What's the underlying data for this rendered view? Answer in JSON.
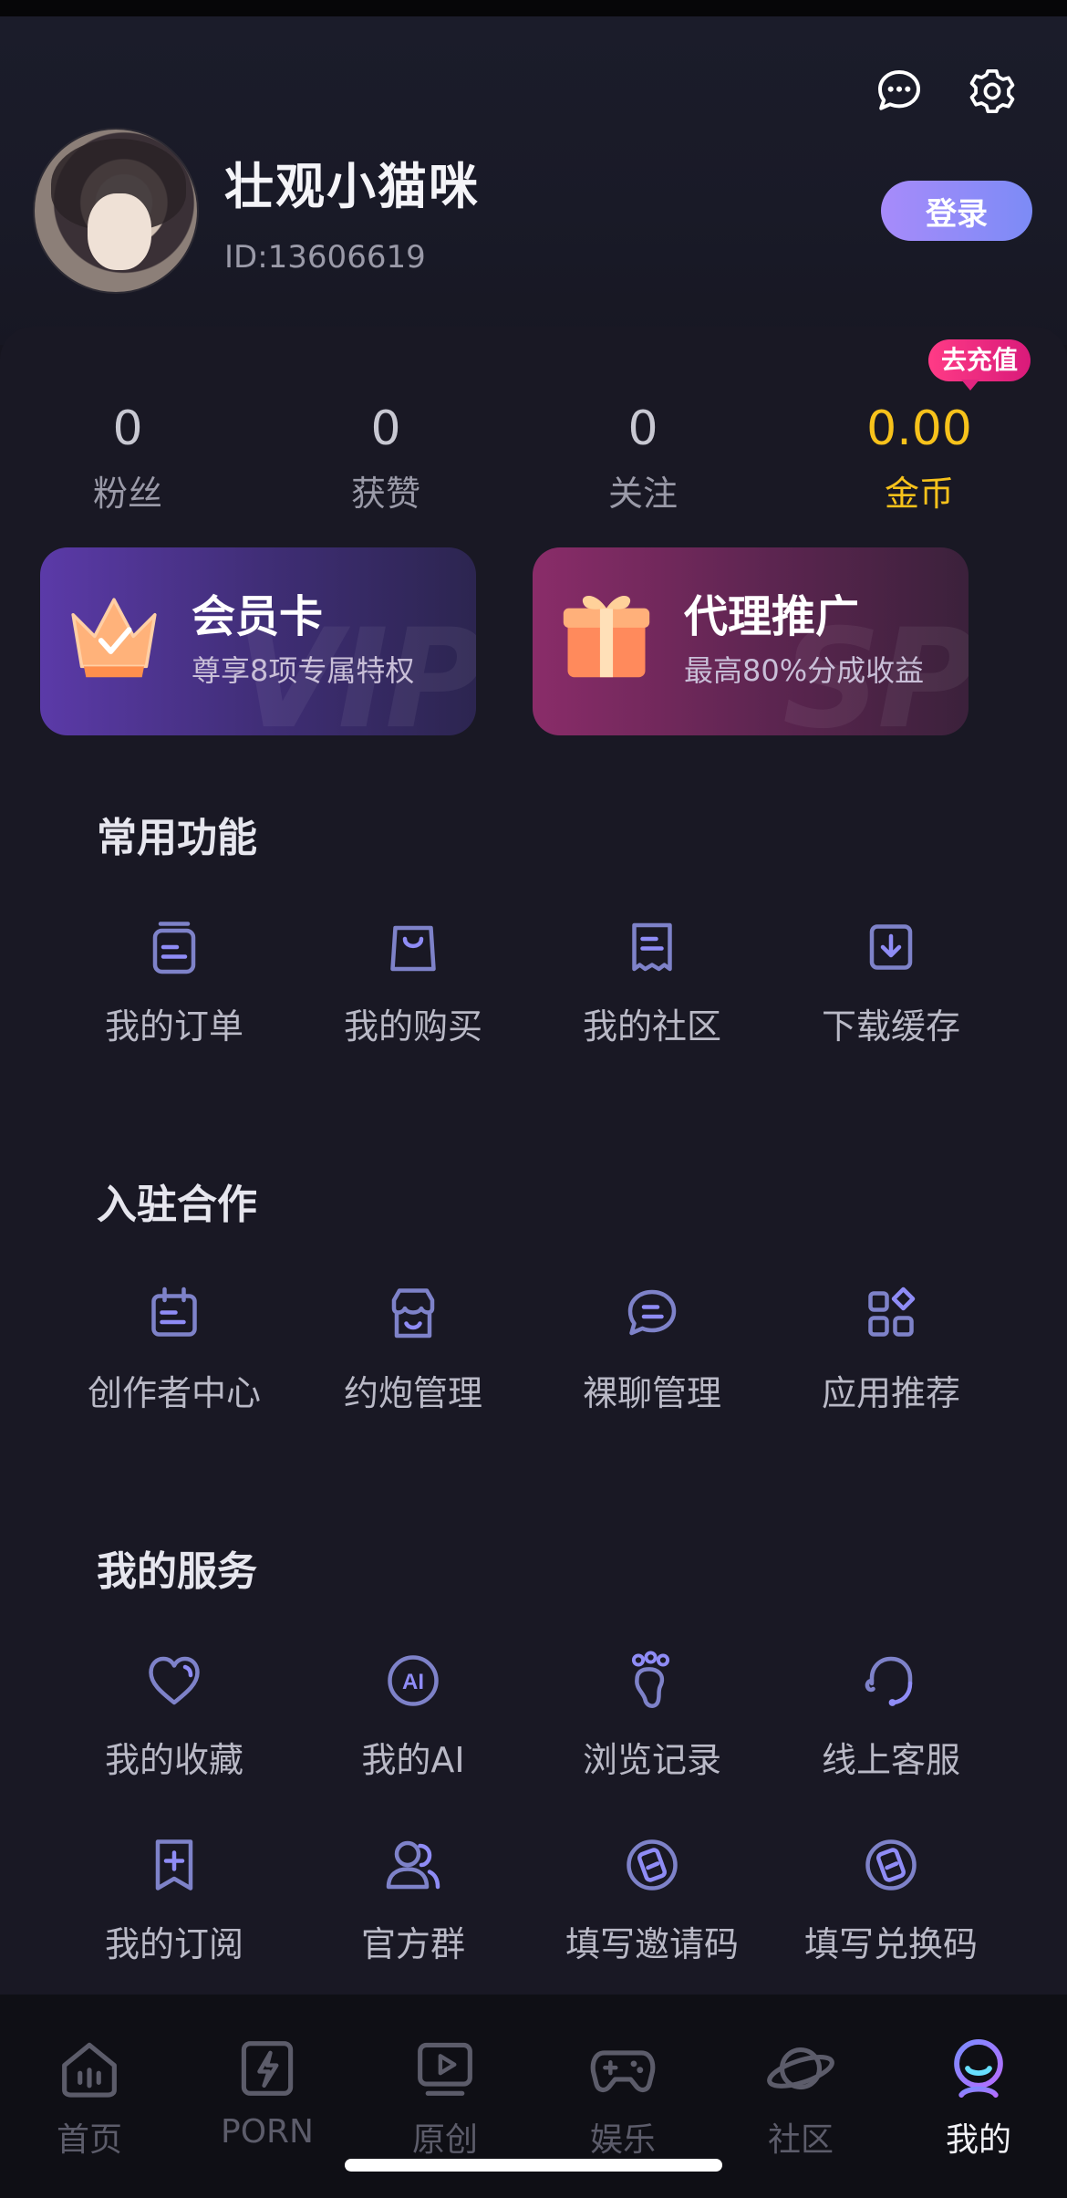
{
  "header": {
    "username": "壮观小猫咪",
    "user_id": "ID:13606619",
    "login_label": "登录",
    "icons": [
      "chat-bubble-icon",
      "gear-icon"
    ]
  },
  "stats": [
    {
      "value": "0",
      "label": "粉丝"
    },
    {
      "value": "0",
      "label": "获赞"
    },
    {
      "value": "0",
      "label": "关注"
    },
    {
      "value": "0.00",
      "label": "金币",
      "color": "#f7c21b"
    }
  ],
  "recharge_badge": "去充值",
  "cards": {
    "vip": {
      "title": "会员卡",
      "subtitle": "尊享8项专属特权",
      "watermark": "VIP"
    },
    "agent": {
      "title": "代理推广",
      "subtitle": "最高80%分成收益",
      "watermark": "SP"
    }
  },
  "sections": {
    "common": {
      "title": "常用功能",
      "items": [
        {
          "label": "我的订单",
          "icon": "order-box-icon"
        },
        {
          "label": "我的购买",
          "icon": "shopping-bag-icon"
        },
        {
          "label": "我的社区",
          "icon": "receipt-icon"
        },
        {
          "label": "下载缓存",
          "icon": "download-icon"
        }
      ]
    },
    "partner": {
      "title": "入驻合作",
      "items": [
        {
          "label": "创作者中心",
          "icon": "calendar-icon"
        },
        {
          "label": "约炮管理",
          "icon": "store-icon"
        },
        {
          "label": "裸聊管理",
          "icon": "chat-icon"
        },
        {
          "label": "应用推荐",
          "icon": "apps-grid-icon"
        }
      ]
    },
    "service": {
      "title": "我的服务",
      "items": [
        {
          "label": "我的收藏",
          "icon": "heart-icon"
        },
        {
          "label": "我的AI",
          "icon": "ai-icon"
        },
        {
          "label": "浏览记录",
          "icon": "footprint-icon"
        },
        {
          "label": "线上客服",
          "icon": "headset-icon"
        },
        {
          "label": "我的订阅",
          "icon": "bookmark-plus-icon"
        },
        {
          "label": "官方群",
          "icon": "group-icon"
        },
        {
          "label": "填写邀请码",
          "icon": "invite-code-icon"
        },
        {
          "label": "填写兑换码",
          "icon": "redeem-code-icon"
        }
      ]
    }
  },
  "tabbar": [
    {
      "label": "首页",
      "icon": "home-icon"
    },
    {
      "label": "PORN",
      "icon": "lightning-icon"
    },
    {
      "label": "原创",
      "icon": "play-screen-icon"
    },
    {
      "label": "娱乐",
      "icon": "gamepad-icon"
    },
    {
      "label": "社区",
      "icon": "planet-icon"
    },
    {
      "label": "我的",
      "icon": "profile-icon",
      "active": true
    }
  ],
  "colors": {
    "accent_purple": "#8f8cf6",
    "gold": "#f7c21b",
    "badge_pink": "#ff3b86",
    "background": "#16151f"
  }
}
